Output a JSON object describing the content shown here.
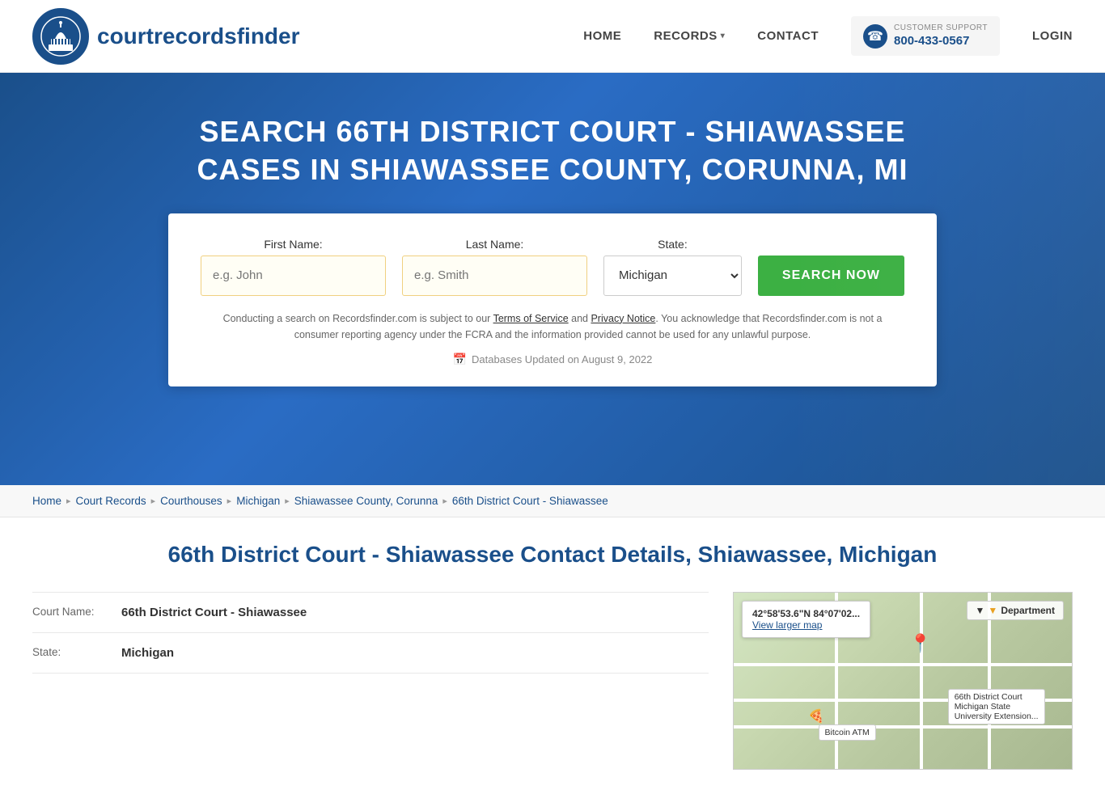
{
  "header": {
    "logo_text_regular": "courtrecords",
    "logo_text_bold": "finder",
    "nav": {
      "home": "HOME",
      "records": "RECORDS",
      "contact": "CONTACT",
      "login": "LOGIN"
    },
    "support": {
      "label": "CUSTOMER SUPPORT",
      "phone": "800-433-0567"
    }
  },
  "hero": {
    "title": "SEARCH 66TH DISTRICT COURT - SHIAWASSEE CASES IN SHIAWASSEE COUNTY, CORUNNA, MI"
  },
  "search": {
    "first_name_label": "First Name:",
    "first_name_placeholder": "e.g. John",
    "last_name_label": "Last Name:",
    "last_name_placeholder": "e.g. Smith",
    "state_label": "State:",
    "state_value": "Michigan",
    "search_button": "SEARCH NOW",
    "disclaimer": "Conducting a search on Recordsfinder.com is subject to our Terms of Service and Privacy Notice. You acknowledge that Recordsfinder.com is not a consumer reporting agency under the FCRA and the information provided cannot be used for any unlawful purpose.",
    "db_updated": "Databases Updated on August 9, 2022",
    "terms_link": "Terms of Service",
    "privacy_link": "Privacy Notice"
  },
  "breadcrumb": {
    "items": [
      {
        "label": "Home",
        "href": "#"
      },
      {
        "label": "Court Records",
        "href": "#"
      },
      {
        "label": "Courthouses",
        "href": "#"
      },
      {
        "label": "Michigan",
        "href": "#"
      },
      {
        "label": "Shiawassee County, Corunna",
        "href": "#"
      },
      {
        "label": "66th District Court - Shiawassee",
        "href": "#"
      }
    ]
  },
  "page": {
    "title": "66th District Court - Shiawassee Contact Details, Shiawassee, Michigan"
  },
  "court_details": {
    "court_name_label": "Court Name:",
    "court_name_value": "66th District Court - Shiawassee",
    "state_label": "State:",
    "state_value": "Michigan"
  },
  "map": {
    "coords": "42°58'53.6\"N 84°07'02...",
    "view_larger": "View larger map",
    "department_header": "Department",
    "poi1": "Bitcoin ATM",
    "poi1_sub": "",
    "poi2_line1": "66th District Court",
    "poi2_line2": "Michigan State",
    "poi2_line3": "University Extension..."
  }
}
